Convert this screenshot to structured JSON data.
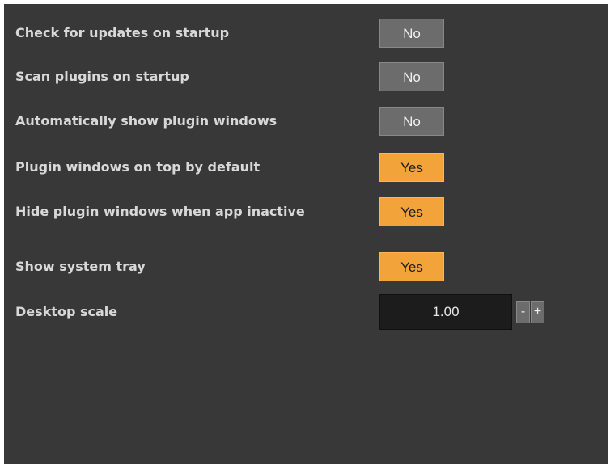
{
  "settings": [
    {
      "label": "Check for updates on startup",
      "value": "No",
      "state": "off"
    },
    {
      "label": "Scan plugins on startup",
      "value": "No",
      "state": "off"
    },
    {
      "label": "Automatically show plugin windows",
      "value": "No",
      "state": "off"
    },
    {
      "label": "Plugin windows on top by default",
      "value": "Yes",
      "state": "on"
    },
    {
      "label": "Hide plugin windows when app inactive",
      "value": "Yes",
      "state": "on"
    },
    {
      "label": "Show system tray",
      "value": "Yes",
      "state": "on"
    }
  ],
  "desktop_scale": {
    "label": "Desktop scale",
    "value": "1.00",
    "decrement_label": "-",
    "increment_label": "+"
  },
  "colors": {
    "panel_background": "#383838",
    "label_text": "#d8d8d8",
    "toggle_off": "#6c6c6c",
    "toggle_on": "#f2a33a",
    "field_background": "#1c1c1c"
  }
}
